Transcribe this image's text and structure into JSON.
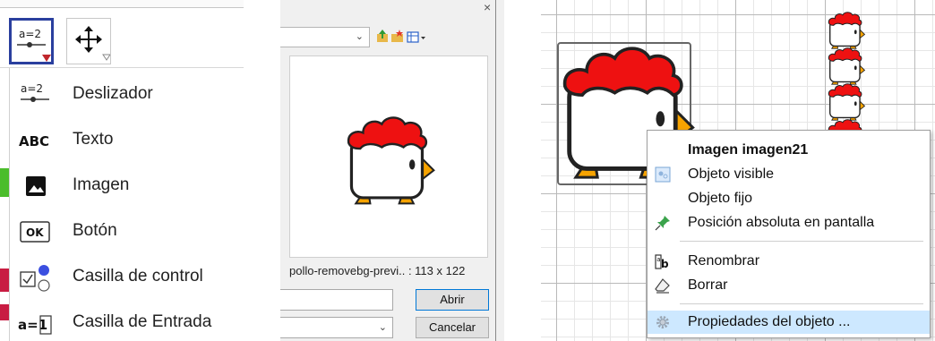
{
  "toolbox": {
    "active_tool_icon": "a=2",
    "tools": [
      {
        "icon_text": "a=2",
        "icon": "slider-icon",
        "label": "Deslizador"
      },
      {
        "icon_text": "ABC",
        "icon": "text-icon",
        "label": "Texto"
      },
      {
        "icon_text": "",
        "icon": "image-icon",
        "label": "Imagen"
      },
      {
        "icon_text": "OK",
        "icon": "button-icon",
        "label": "Botón"
      },
      {
        "icon_text": "",
        "icon": "checkbox-icon",
        "label": "Casilla de control"
      },
      {
        "icon_text": "a=1",
        "icon": "input-box-icon",
        "label": "Casilla de Entrada"
      }
    ],
    "colors": {
      "active_border": "#2a3f9e",
      "triangle": "#c0272d"
    }
  },
  "file_dialog": {
    "close_glyph": "×",
    "preview_caption": "pollo-removebg-previ.. : 113 x 122",
    "open_button": "Abrir",
    "cancel_button": "Cancelar",
    "colors": {
      "primary_border": "#0078d7"
    }
  },
  "context_menu": {
    "title": "Imagen imagen21",
    "items": [
      {
        "label": "Objeto visible",
        "icon": "visible-icon"
      },
      {
        "label": "Objeto fijo",
        "icon": ""
      },
      {
        "label": "Posición absoluta en pantalla",
        "icon": "pin-icon"
      },
      {
        "label": "Renombrar",
        "icon": "rename-icon"
      },
      {
        "label": "Borrar",
        "icon": "eraser-icon"
      },
      {
        "label": "Propiedades del objeto ...",
        "icon": "gear-icon",
        "highlighted": true
      }
    ],
    "colors": {
      "highlight": "#cde8ff",
      "chicken_red": "#ee1111",
      "chicken_orange": "#f6a300"
    }
  }
}
